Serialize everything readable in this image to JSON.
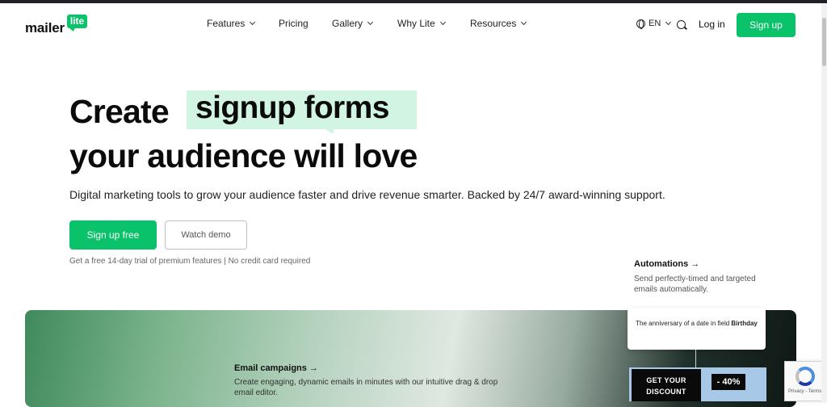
{
  "header": {
    "logo": {
      "word": "mailer",
      "badge": "lite"
    },
    "nav": [
      {
        "label": "Features",
        "has_dropdown": true
      },
      {
        "label": "Pricing",
        "has_dropdown": false
      },
      {
        "label": "Gallery",
        "has_dropdown": true
      },
      {
        "label": "Why Lite",
        "has_dropdown": true
      },
      {
        "label": "Resources",
        "has_dropdown": true
      }
    ],
    "language": "EN",
    "login_label": "Log in",
    "signup_label": "Sign up"
  },
  "hero": {
    "headline_start": "Create",
    "headline_highlight": "signup forms",
    "headline_end": "your audience will love",
    "subtitle": "Digital marketing tools to grow your audience faster and drive revenue smarter. Backed by 24/7 award-winning support.",
    "primary_button": "Sign up free",
    "secondary_button": "Watch demo",
    "trial_note": "Get a free 14-day trial of premium features | No credit card required"
  },
  "automations": {
    "title": "Automations →",
    "description": "Send perfectly-timed and targeted emails automatically."
  },
  "campaigns": {
    "title": "Email campaigns →",
    "description": "Create engaging, dynamic emails in minutes with our intuitive drag & drop email editor."
  },
  "trigger_card": {
    "text": "The anniversary of a date in field",
    "field": "Birthday"
  },
  "promo": {
    "line1": "GET YOUR",
    "line2": "DISCOUNT",
    "percent": "- 40%"
  },
  "recaptcha": {
    "links": "Privacy - Terms"
  },
  "colors": {
    "brand_green": "#09c269",
    "highlight": "#d2f4e2"
  }
}
